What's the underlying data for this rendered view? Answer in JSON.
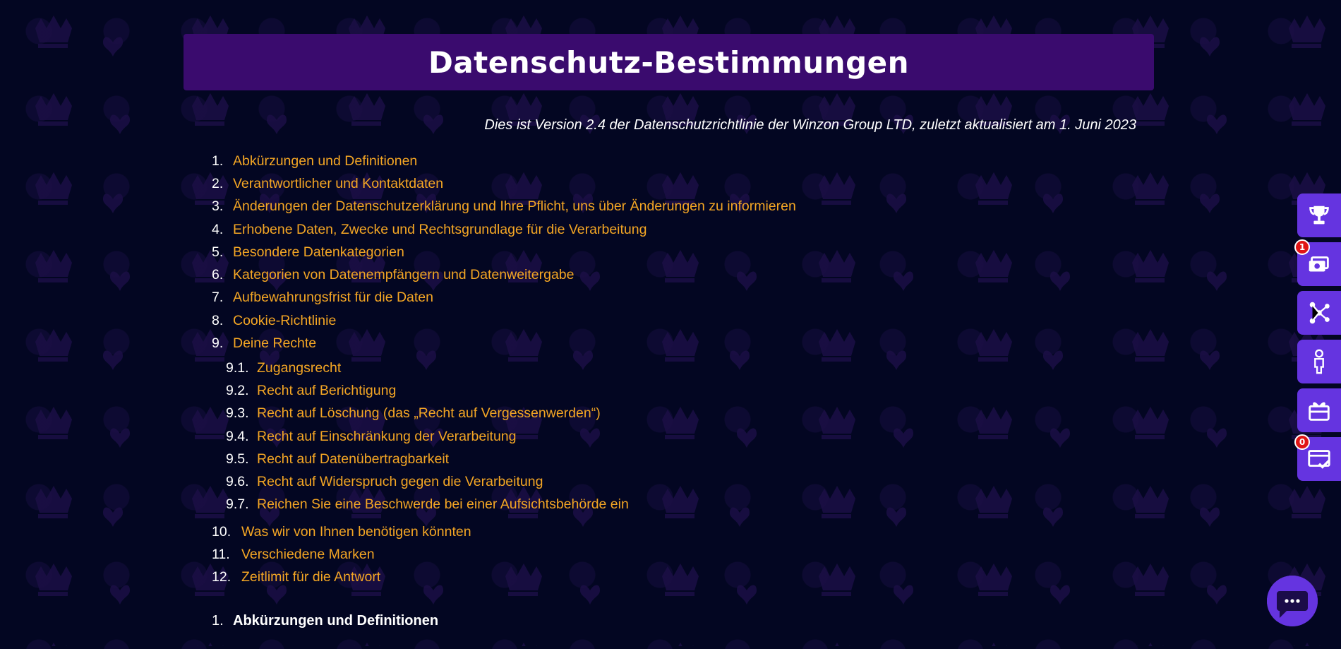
{
  "page": {
    "title": "Datenschutz-Bestimmungen",
    "version_note": "Dies ist Version 2.4 der Datenschutzrichtlinie der Winzon Group LTD, zuletzt aktualisiert am 1. Juni 2023"
  },
  "toc": {
    "items": [
      {
        "num": "1.",
        "label": "Abkürzungen und Definitionen"
      },
      {
        "num": "2.",
        "label": "Verantwortlicher und Kontaktdaten"
      },
      {
        "num": "3.",
        "label": "Änderungen der Datenschutzerklärung und Ihre Pflicht, uns über Änderungen zu informieren"
      },
      {
        "num": "4.",
        "label": "Erhobene Daten, Zwecke und Rechtsgrundlage für die Verarbeitung"
      },
      {
        "num": "5.",
        "label": "Besondere Datenkategorien"
      },
      {
        "num": "6.",
        "label": "Kategorien von Datenempfängern und Datenweitergabe"
      },
      {
        "num": "7.",
        "label": "Aufbewahrungsfrist für die Daten"
      },
      {
        "num": "8.",
        "label": "Cookie-Richtlinie"
      },
      {
        "num": "9.",
        "label": "Deine Rechte"
      }
    ],
    "sub_items": [
      {
        "num": "9.1.",
        "label": "Zugangsrecht"
      },
      {
        "num": "9.2.",
        "label": "Recht auf Berichtigung"
      },
      {
        "num": "9.3.",
        "label": "Recht auf Löschung (das „Recht auf Vergessenwerden“)"
      },
      {
        "num": "9.4.",
        "label": "Recht auf Einschränkung der Verarbeitung"
      },
      {
        "num": "9.5.",
        "label": "Recht auf Datenübertragbarkeit"
      },
      {
        "num": "9.6.",
        "label": "Recht auf Widerspruch gegen die Verarbeitung"
      },
      {
        "num": "9.7.",
        "label": "Reichen Sie eine Beschwerde bei einer Aufsichtsbehörde ein"
      }
    ],
    "items_end": [
      {
        "num": "10.",
        "label": "Was wir von Ihnen benötigen könnten"
      },
      {
        "num": "11.",
        "label": "Verschiedene Marken"
      },
      {
        "num": "12.",
        "label": "Zeitlimit für die Antwort"
      }
    ]
  },
  "section": {
    "num": "1.",
    "heading": "Abkürzungen und Definitionen"
  },
  "side_buttons": [
    {
      "icon": "trophy-icon"
    },
    {
      "icon": "money-icon",
      "badge": "1"
    },
    {
      "icon": "network-icon"
    },
    {
      "icon": "person-icon"
    },
    {
      "icon": "gift-icon"
    },
    {
      "icon": "checklist-card-icon",
      "badge": "0"
    }
  ],
  "colors": {
    "background": "#030622",
    "title_bar": "#3a0b6e",
    "link": "#f4a624",
    "side_button": "#6534e0",
    "badge": "#e01515"
  }
}
